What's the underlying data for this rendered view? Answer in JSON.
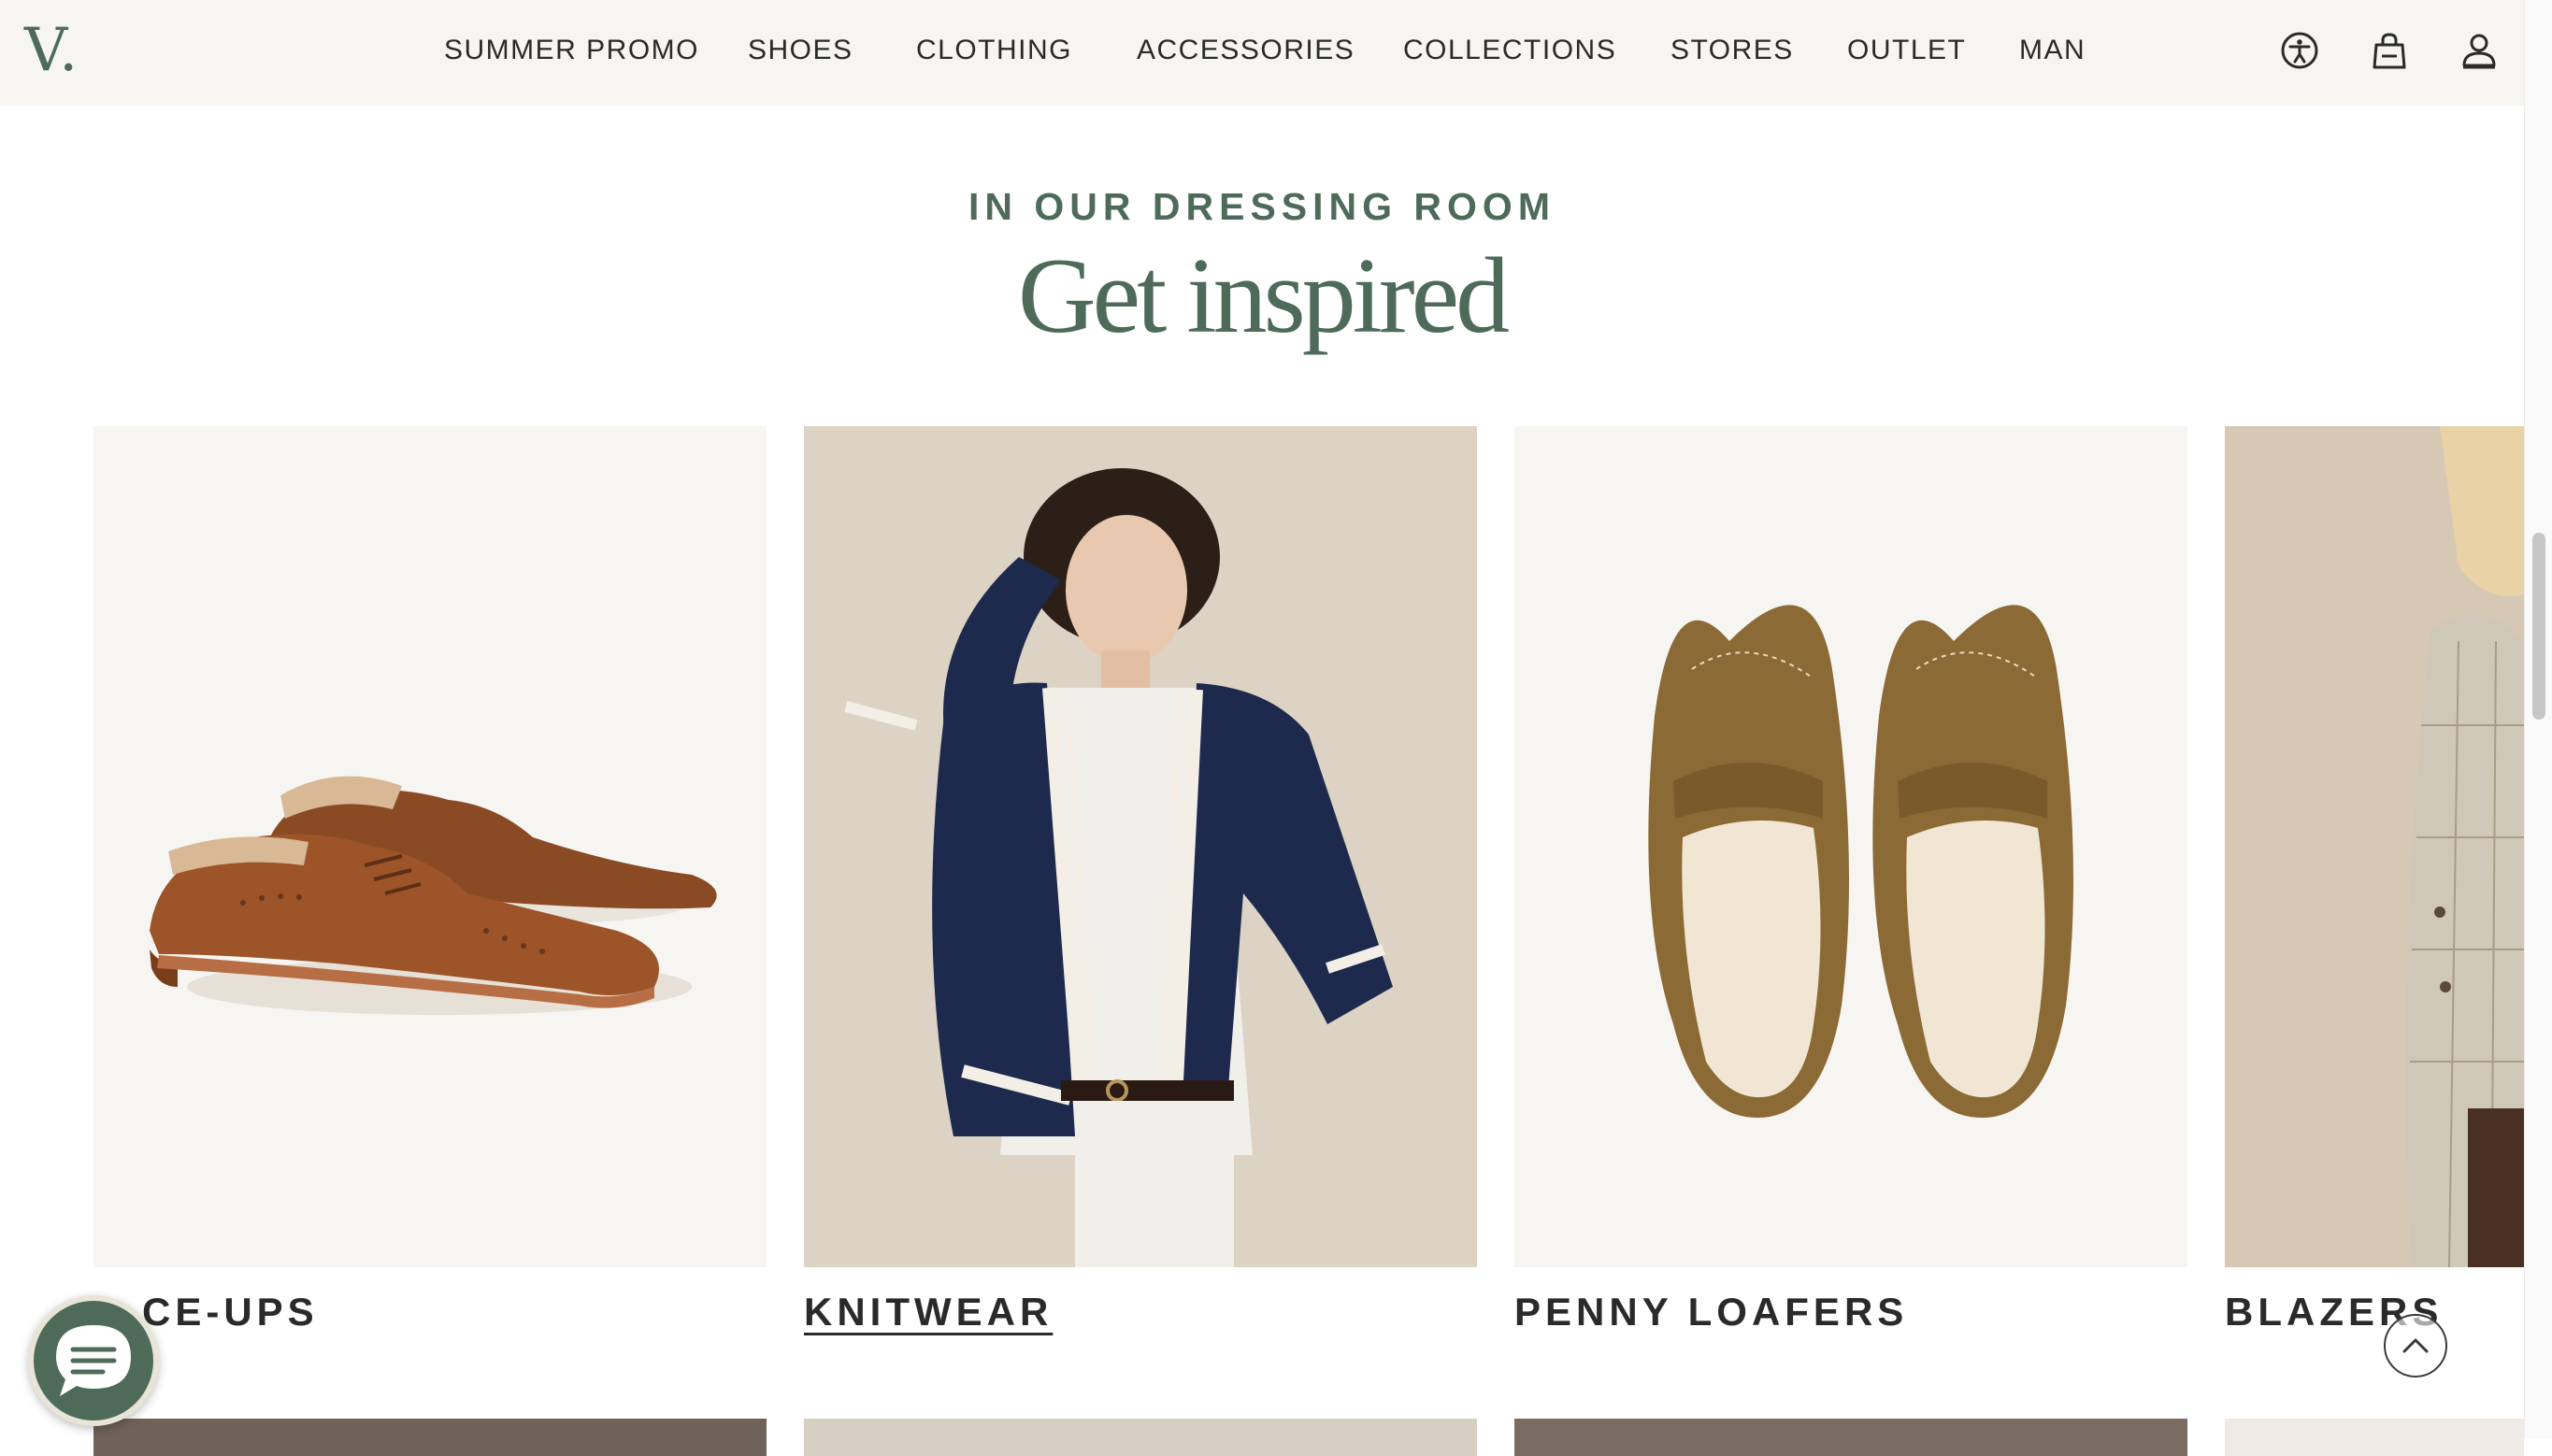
{
  "brand": {
    "logo_text": "V."
  },
  "nav": {
    "items": [
      {
        "label": "SUMMER PROMO"
      },
      {
        "label": "SHOES"
      },
      {
        "label": "CLOTHING"
      },
      {
        "label": "ACCESSORIES"
      },
      {
        "label": "COLLECTIONS"
      },
      {
        "label": "STORES"
      },
      {
        "label": "OUTLET"
      },
      {
        "label": "MAN"
      }
    ],
    "icons": [
      "accessibility-icon",
      "shopping-bag-icon",
      "account-icon"
    ]
  },
  "section": {
    "eyebrow": "IN OUR DRESSING ROOM",
    "title": "Get inspired"
  },
  "cards": [
    {
      "label": "CE-UPS",
      "image": "brown-suede-brogue-shoes"
    },
    {
      "label": "KNITWEAR",
      "image": "woman-navy-cardigan",
      "active": true
    },
    {
      "label": "PENNY LOAFERS",
      "image": "tan-suede-penny-loafers"
    },
    {
      "label": "BLAZERS",
      "image": "woman-check-blazer"
    }
  ],
  "colors": {
    "brand_green": "#4e6b5a",
    "header_bg": "#f6f5f1",
    "text": "#2a2a2a"
  },
  "floating": {
    "chat_icon": "chat-icon",
    "back_to_top_icon": "chevron-up-icon"
  }
}
